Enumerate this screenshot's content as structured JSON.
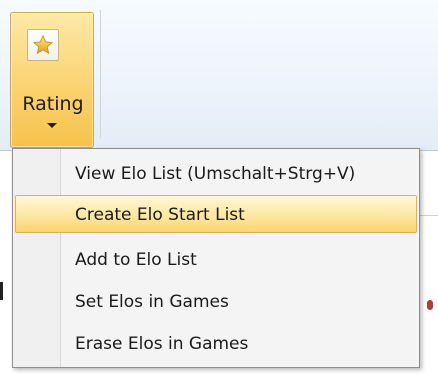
{
  "ribbon": {
    "rating_button": {
      "label": "Rating",
      "icon": "star-icon"
    }
  },
  "menu": {
    "items": [
      {
        "label": "View Elo List (Umschalt+Strg+V)",
        "highlighted": false
      },
      {
        "label": "Create Elo Start List",
        "highlighted": true
      },
      {
        "label": "Add to Elo List",
        "highlighted": false
      },
      {
        "label": "Set Elos in Games",
        "highlighted": false
      },
      {
        "label": "Erase Elos in Games",
        "highlighted": false
      }
    ]
  },
  "colors": {
    "ribbon_button_active": "#f7c24b",
    "menu_highlight": "#fde8a0",
    "menu_background": "#f4f4f4"
  }
}
